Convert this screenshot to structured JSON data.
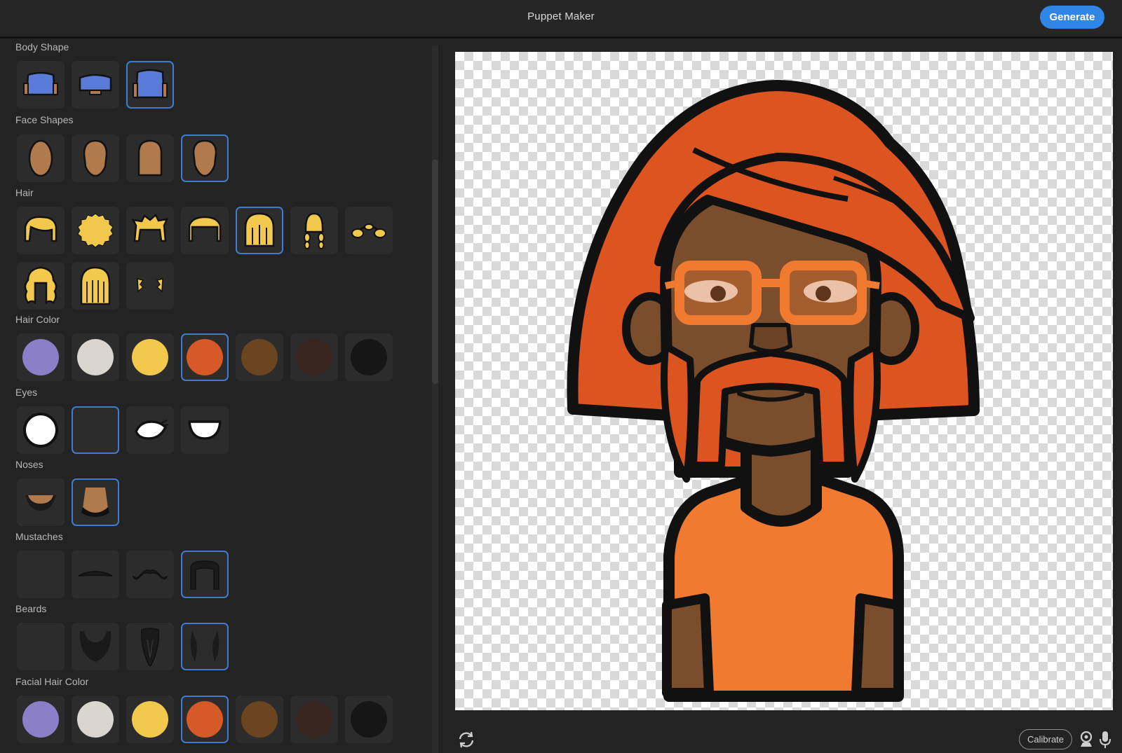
{
  "app": {
    "title": "Puppet Maker",
    "generate_label": "Generate"
  },
  "sections": {
    "body_shape": "Body Shape",
    "face_shapes": "Face Shapes",
    "hair": "Hair",
    "hair_color": "Hair Color",
    "eyes": "Eyes",
    "noses": "Noses",
    "mustaches": "Mustaches",
    "beards": "Beards",
    "facial_hair_color": "Facial Hair Color"
  },
  "selected": {
    "body_shape": 3,
    "face_shape": 4,
    "hair": 5,
    "hair_color": 4,
    "eyes": 2,
    "nose": 2,
    "mustache": 4,
    "beard": 4,
    "facial_hair_color": 4
  },
  "colors": {
    "accent": "#2f86e6",
    "selection": "#3f7ccf",
    "hair_swatches": [
      "#8b80c8",
      "#d9d6d0",
      "#f2c94c",
      "#d55a28",
      "#6b4420",
      "#3a2620",
      "#161616"
    ],
    "facial_hair_swatches": [
      "#8b80c8",
      "#d9d6d0",
      "#f2c94c",
      "#d55a28",
      "#6b4420",
      "#3a2620",
      "#161616"
    ],
    "puppet_hair": "#dc5420",
    "puppet_skin": "#7a4e2d",
    "puppet_shirt": "#f07a30",
    "puppet_glasses": "#f07a30"
  },
  "controls": {
    "calibrate_label": "Calibrate",
    "refresh_icon": "refresh-icon",
    "camera_icon": "camera-icon",
    "mic_icon": "microphone-icon"
  }
}
